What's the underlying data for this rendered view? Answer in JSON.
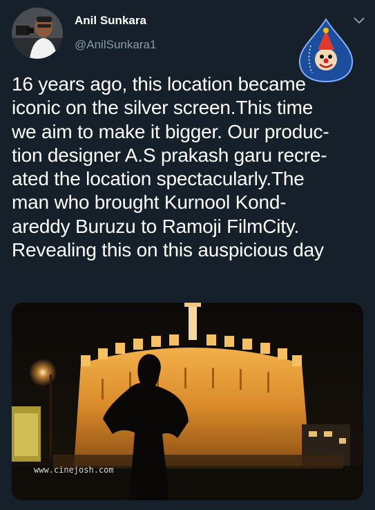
{
  "tweet": {
    "author_name": "Anil Sunkara",
    "author_handle": "@AnilSunkara1",
    "text": "16 years ago, this location became\niconic on the silver screen.This time\nwe aim to make it bigger. Our produc-\ntion designer A.S prakash garu recre-\nated the location spectacularly.The\nman who brought Kurnool Kond-\nareddy Buruzu to Ramoji FilmCity.\nRevealing this on this auspicious day"
  },
  "media": {
    "watermark_text": "www.cinejosh.com"
  },
  "icons": {
    "menu": "chevron-down-icon",
    "logo": "cinejosh-logo"
  },
  "colors": {
    "background": "#15202b",
    "primary_text": "#ffffff",
    "secondary_text": "#8899a6"
  }
}
